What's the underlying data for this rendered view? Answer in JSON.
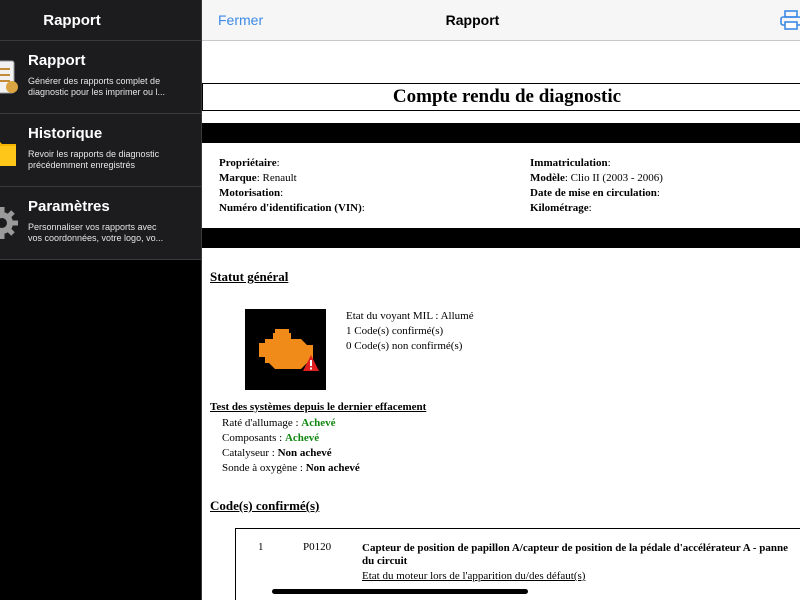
{
  "sidebar": {
    "title": "Rapport",
    "items": [
      {
        "title": "Rapport",
        "desc1": "Générer des rapports complet de",
        "desc2": "diagnostic pour les imprimer ou l...",
        "icon": "report-icon"
      },
      {
        "title": "Historique",
        "desc1": "Revoir les rapports de diagnostic",
        "desc2": "précédemment enregistrés",
        "icon": "folder-icon"
      },
      {
        "title": "Paramètres",
        "desc1": "Personnaliser vos rapports avec",
        "desc2": "vos coordonnées, votre logo, vo...",
        "icon": "gear-icon"
      }
    ]
  },
  "nav": {
    "close_label": "Fermer",
    "title": "Rapport",
    "print_icon": "print-icon",
    "accent": "#3c8ae6"
  },
  "report": {
    "title": "Compte rendu de diagnostic",
    "left": [
      {
        "label": "Propriétaire",
        "value": ""
      },
      {
        "label": "Marque",
        "value": " Renault"
      },
      {
        "label": "Motorisation",
        "value": ""
      },
      {
        "label": "Numéro d'identification (VIN)",
        "value": ""
      }
    ],
    "right": [
      {
        "label": "Immatriculation",
        "value": ""
      },
      {
        "label": "Modèle",
        "value": " Clio II (2003 - 2006)"
      },
      {
        "label": "Date de mise en circulation",
        "value": ""
      },
      {
        "label": "Kilométrage",
        "value": ""
      }
    ],
    "status_heading": "Statut général",
    "mil_state": "Etat du voyant MIL : Allumé",
    "confirmed": "1 Code(s) confirmé(s)",
    "unconfirmed": "0 Code(s) non confirmé(s)",
    "tests_heading": "Test des systèmes depuis le dernier effacement",
    "tests": [
      {
        "label": "Raté d'allumage : ",
        "value": "Achevé",
        "ok": true
      },
      {
        "label": "Composants : ",
        "value": "Achevé",
        "ok": true
      },
      {
        "label": "Catalyseur : ",
        "value": "Non achevé",
        "ok": false
      },
      {
        "label": "Sonde à oxygène : ",
        "value": "Non achevé",
        "ok": false
      }
    ],
    "codes_heading": "Code(s) confirmé(s)",
    "codes": [
      {
        "num": "1",
        "code": "P0120",
        "desc1": "Capteur de position de papillon A/capteur de position de la pédale d'accélérateur A - panne",
        "desc2": "du circuit",
        "link": "Etat du moteur lors de l'apparition du/des défaut(s)"
      }
    ],
    "ok_color": "#118811",
    "engine_color": "#f08a18",
    "warning_color": "#e02020"
  }
}
